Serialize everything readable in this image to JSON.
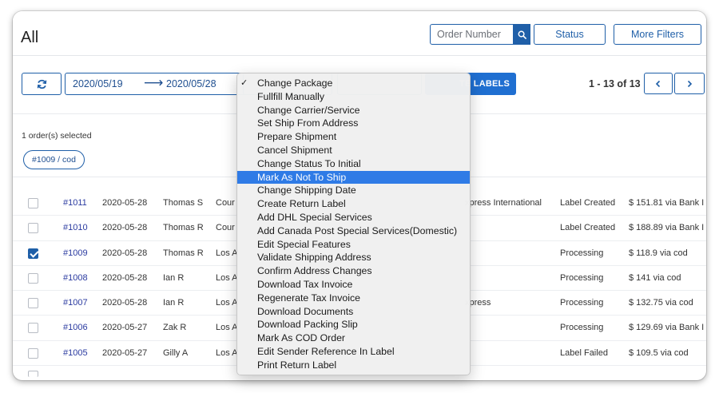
{
  "header": {
    "title": "All",
    "search_placeholder": "Order Number",
    "status_label": "Status",
    "more_filters_label": "More Filters"
  },
  "toolbar": {
    "date_start": "2020/05/19",
    "date_arrow": "⟶",
    "date_end": "2020/05/28",
    "labels_button": "TE LABELS",
    "pagination": "1 - 13 of 13"
  },
  "selection": {
    "count_text": "1 order(s) selected",
    "chip": "#1009 / cod"
  },
  "menu": {
    "items": [
      {
        "label": "Change Package",
        "checked": true
      },
      {
        "label": "Fullfill Manually"
      },
      {
        "label": "Change Carrier/Service"
      },
      {
        "label": "Set Ship From Address"
      },
      {
        "label": "Prepare Shipment"
      },
      {
        "label": "Cancel Shipment"
      },
      {
        "label": "Change Status To Initial"
      },
      {
        "label": "Mark As Not To Ship",
        "highlighted": true
      },
      {
        "label": "Change Shipping Date"
      },
      {
        "label": "Create Return Label"
      },
      {
        "label": "Add DHL Special Services"
      },
      {
        "label": "Add Canada Post Special Services(Domestic)"
      },
      {
        "label": "Edit Special Features"
      },
      {
        "label": "Validate Shipping Address"
      },
      {
        "label": "Confirm Address Changes"
      },
      {
        "label": "Download Tax Invoice"
      },
      {
        "label": "Regenerate Tax Invoice"
      },
      {
        "label": "Download Documents"
      },
      {
        "label": "Download Packing Slip"
      },
      {
        "label": "Mark As COD Order"
      },
      {
        "label": "Edit Sender Reference In Label"
      },
      {
        "label": "Print Return Label"
      }
    ]
  },
  "orders": [
    {
      "id": "#1011",
      "date": "2020-05-28",
      "name": "Thomas S",
      "loc": "Cour",
      "carrier": "xpress International",
      "status": "Label Created",
      "amount": "$ 151.81 via Bank I",
      "checked": false
    },
    {
      "id": "#1010",
      "date": "2020-05-28",
      "name": "Thomas R",
      "loc": "Cour",
      "carrier": "",
      "status": "Label Created",
      "amount": "$ 188.89 via Bank I",
      "checked": false
    },
    {
      "id": "#1009",
      "date": "2020-05-28",
      "name": "Thomas R",
      "loc": "Los A",
      "carrier": "",
      "status": "Processing",
      "amount": "$ 118.9 via cod",
      "checked": true
    },
    {
      "id": "#1008",
      "date": "2020-05-28",
      "name": "Ian R",
      "loc": "Los A",
      "carrier": "",
      "status": "Processing",
      "amount": "$ 141 via cod",
      "checked": false
    },
    {
      "id": "#1007",
      "date": "2020-05-28",
      "name": "Ian R",
      "loc": "Los A",
      "carrier": "xpress",
      "status": "Processing",
      "amount": "$ 132.75 via cod",
      "checked": false
    },
    {
      "id": "#1006",
      "date": "2020-05-27",
      "name": "Zak R",
      "loc": "Los A",
      "carrier": "",
      "status": "Processing",
      "amount": "$ 129.69 via Bank I",
      "checked": false
    },
    {
      "id": "#1005",
      "date": "2020-05-27",
      "name": "Gilly A",
      "loc": "Los A",
      "carrier": "",
      "status": "Label Failed",
      "amount": "$ 109.5 via cod",
      "checked": false
    }
  ],
  "colors": {
    "primary": "#1f5fa8",
    "button_fill": "#1f6fd1",
    "menu_highlight": "#2f7be6",
    "order_link": "#2a3aa0"
  },
  "icons": {
    "search": "magnifier-icon",
    "refresh": "refresh-icon",
    "prev": "chevron-left-icon",
    "next": "chevron-right-icon",
    "check": "checkmark-icon"
  }
}
